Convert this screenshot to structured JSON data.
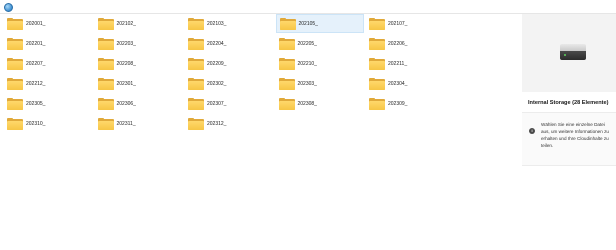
{
  "header": {
    "icon": "globe-icon"
  },
  "folders": [
    {
      "name": "202001_",
      "selected": false
    },
    {
      "name": "202102_",
      "selected": false
    },
    {
      "name": "202103_",
      "selected": false
    },
    {
      "name": "202105_",
      "selected": true
    },
    {
      "name": "202107_",
      "selected": false
    },
    {
      "name": "202201_",
      "selected": false
    },
    {
      "name": "202203_",
      "selected": false
    },
    {
      "name": "202204_",
      "selected": false
    },
    {
      "name": "202205_",
      "selected": false
    },
    {
      "name": "202206_",
      "selected": false
    },
    {
      "name": "202207_",
      "selected": false
    },
    {
      "name": "202208_",
      "selected": false
    },
    {
      "name": "202209_",
      "selected": false
    },
    {
      "name": "202210_",
      "selected": false
    },
    {
      "name": "202211_",
      "selected": false
    },
    {
      "name": "202212_",
      "selected": false
    },
    {
      "name": "202301_",
      "selected": false
    },
    {
      "name": "202302_",
      "selected": false
    },
    {
      "name": "202303_",
      "selected": false
    },
    {
      "name": "202304_",
      "selected": false
    },
    {
      "name": "202305_",
      "selected": false
    },
    {
      "name": "202306_",
      "selected": false
    },
    {
      "name": "202307_",
      "selected": false
    },
    {
      "name": "202308_",
      "selected": false
    },
    {
      "name": "202309_",
      "selected": false
    },
    {
      "name": "202310_",
      "selected": false
    },
    {
      "name": "202311_",
      "selected": false
    },
    {
      "name": "202312_",
      "selected": false
    }
  ],
  "details_pane": {
    "icon": "storage-drive-icon",
    "title": "Internal Storage (28 Elemente)",
    "info_icon": "info-icon",
    "info_text": "Wählen Sie eine einzelne Datei aus, um weitere Informationen zu erhalten und Ihre Cloudinhalte zu teilen."
  },
  "colors": {
    "selection_bg": "#e5f1fb",
    "selection_border": "#cce4f7",
    "folder_yellow": "#f7c646",
    "pane_bg": "#f3f3f3"
  }
}
